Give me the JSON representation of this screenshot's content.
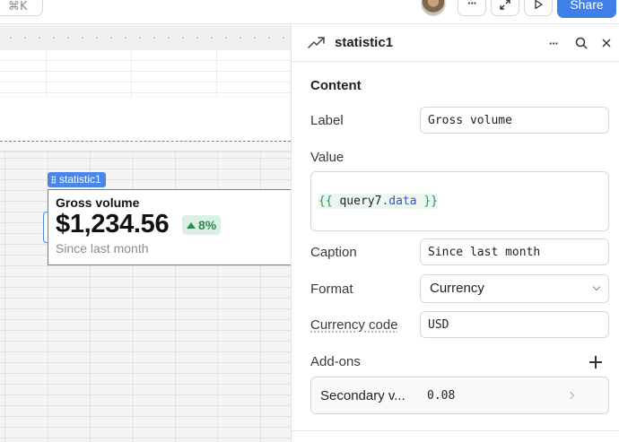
{
  "topbar": {
    "shortcut_hint": "⌘K",
    "more_label": "···",
    "share_label": "Share"
  },
  "component": {
    "name": "statistic1",
    "label": "Gross volume",
    "value": "$1,234.56",
    "change": "8%",
    "caption": "Since last month"
  },
  "inspector": {
    "title": "statistic1",
    "more_label": "···",
    "section": "Content",
    "label_label": "Label",
    "label_value": "Gross volume",
    "value_label": "Value",
    "value_code": {
      "open": "{{",
      "identifier": "query7",
      "dot": ".",
      "property": "data",
      "close": "}}"
    },
    "caption_label": "Caption",
    "caption_value": "Since last month",
    "format_label": "Format",
    "format_value": "Currency",
    "currency_code_label": "Currency code",
    "currency_code_value": "USD",
    "addons_label": "Add-ons",
    "addon_name": "Secondary v...",
    "addon_value": "0.08"
  },
  "colors": {
    "accent": "#4a86e8",
    "share": "#3f7fe6",
    "positive": "#2a8a52",
    "positive_bg": "#dcefe3"
  }
}
